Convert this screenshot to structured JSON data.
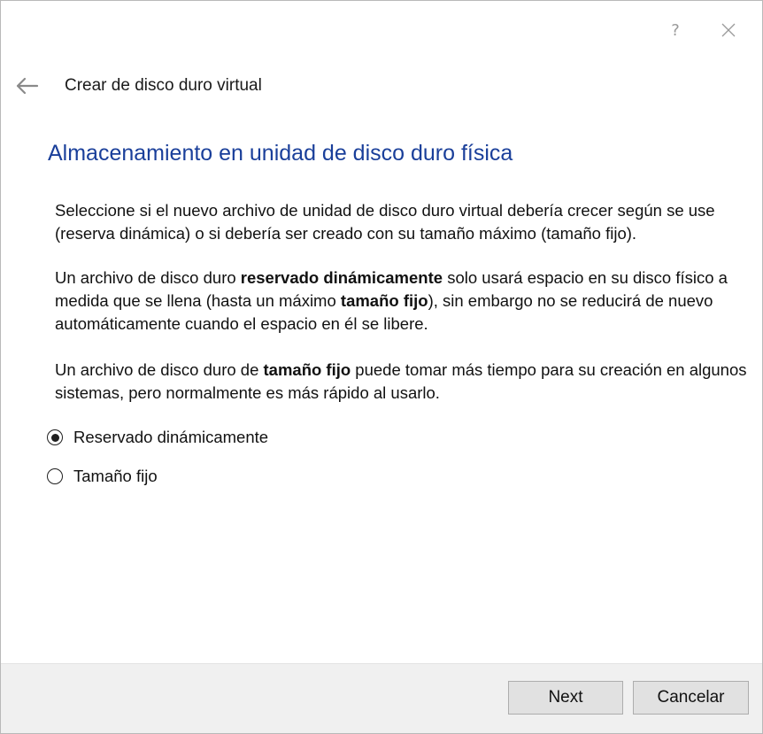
{
  "window": {
    "help_label": "?",
    "close_icon": "close-icon"
  },
  "header": {
    "back_icon": "arrow-left-icon",
    "title": "Crear de disco duro virtual"
  },
  "page": {
    "heading": "Almacenamiento en unidad de disco duro física",
    "p1": "Seleccione si el nuevo archivo de unidad de disco duro virtual debería crecer según se use (reserva dinámica) o si debería ser creado con su tamaño máximo (tamaño fijo).",
    "p2": {
      "a": "Un archivo de disco duro ",
      "b": "reservado dinámicamente",
      "c": " solo usará espacio en su disco físico a medida que se llena (hasta un máximo ",
      "d": "tamaño fijo",
      "e": "), sin embargo no se reducirá de nuevo automáticamente cuando el espacio en él se libere."
    },
    "p3": {
      "a": "Un archivo de disco duro de ",
      "b": "tamaño fijo",
      "c": " puede tomar más tiempo para su creación en algunos sistemas, pero normalmente es más rápido al usarlo."
    }
  },
  "options": [
    {
      "label": "Reservado dinámicamente",
      "selected": true
    },
    {
      "label": "Tamaño fijo",
      "selected": false
    }
  ],
  "footer": {
    "next_label": "Next",
    "cancel_label": "Cancelar"
  },
  "colors": {
    "heading": "#1a3f9a",
    "footer_bg": "#f0f0f0",
    "button_bg": "#e1e1e1"
  }
}
